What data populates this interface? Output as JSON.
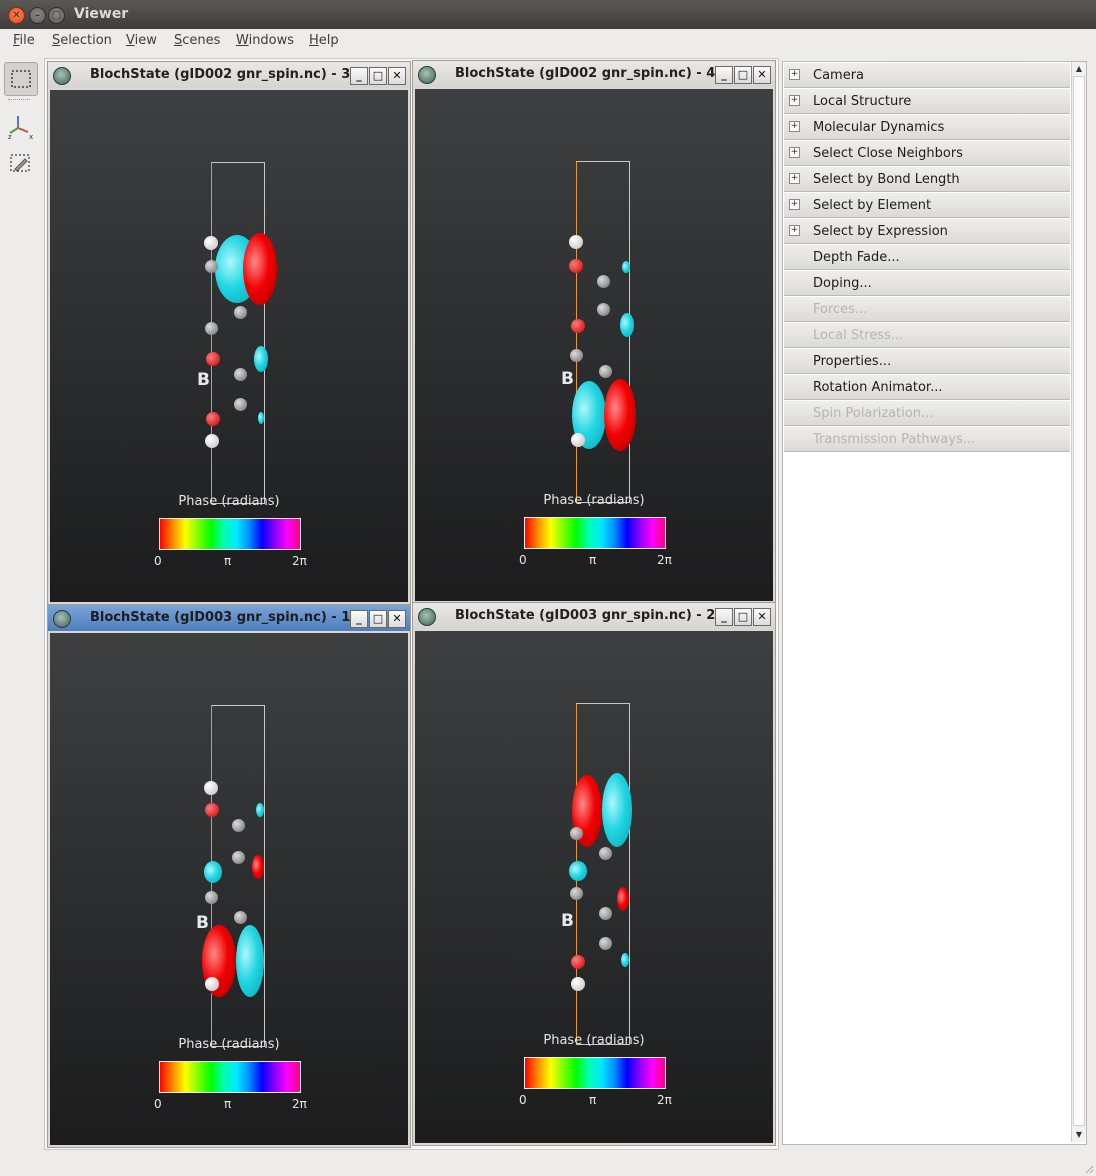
{
  "window": {
    "title": "Viewer"
  },
  "menu": [
    {
      "label": "File"
    },
    {
      "label": "Selection"
    },
    {
      "label": "View"
    },
    {
      "label": "Scenes"
    },
    {
      "label": "Windows"
    },
    {
      "label": "Help"
    }
  ],
  "toolbar": {
    "icons": [
      "rectangle-select-icon",
      "axis-icon",
      "lasso-select-icon"
    ]
  },
  "subwindows": [
    {
      "title": "BlochState (gID002 gnr_spin.nc) - 3",
      "active": false,
      "phase_label": "Phase (radians)",
      "ticks": [
        "0",
        "π",
        "2π"
      ],
      "atom_label": "B"
    },
    {
      "title": "BlochState (gID002 gnr_spin.nc) - 4",
      "active": false,
      "phase_label": "Phase (radians)",
      "ticks": [
        "0",
        "π",
        "2π"
      ],
      "atom_label": "B"
    },
    {
      "title": "BlochState (gID003 gnr_spin.nc) - 1",
      "active": true,
      "phase_label": "Phase (radians)",
      "ticks": [
        "0",
        "π",
        "2π"
      ],
      "atom_label": "B"
    },
    {
      "title": "BlochState (gID003 gnr_spin.nc) - 2",
      "active": false,
      "phase_label": "Phase (radians)",
      "ticks": [
        "0",
        "π",
        "2π"
      ],
      "atom_label": "B"
    }
  ],
  "subwindow_buttons": {
    "minimize": "_",
    "maximize": "□",
    "close": "✕"
  },
  "panel": {
    "items": [
      {
        "label": "Camera",
        "expandable": true,
        "enabled": true
      },
      {
        "label": "Local Structure",
        "expandable": true,
        "enabled": true
      },
      {
        "label": "Molecular Dynamics",
        "expandable": true,
        "enabled": true
      },
      {
        "label": "Select Close Neighbors",
        "expandable": true,
        "enabled": true
      },
      {
        "label": "Select by Bond Length",
        "expandable": true,
        "enabled": true
      },
      {
        "label": "Select by Element",
        "expandable": true,
        "enabled": true
      },
      {
        "label": "Select by Expression",
        "expandable": true,
        "enabled": true
      },
      {
        "label": "Depth Fade...",
        "expandable": false,
        "enabled": true
      },
      {
        "label": "Doping...",
        "expandable": false,
        "enabled": true
      },
      {
        "label": "Forces...",
        "expandable": false,
        "enabled": false
      },
      {
        "label": "Local Stress...",
        "expandable": false,
        "enabled": false
      },
      {
        "label": "Properties...",
        "expandable": false,
        "enabled": true
      },
      {
        "label": "Rotation Animator...",
        "expandable": false,
        "enabled": true
      },
      {
        "label": "Spin Polarization...",
        "expandable": false,
        "enabled": false
      },
      {
        "label": "Transmission Pathways...",
        "expandable": false,
        "enabled": false
      }
    ]
  },
  "colors": {
    "accent_active_title": "#4d7fbd",
    "viewport_bg": "#1c1c1d",
    "lobe_positive": "#20d6e2",
    "lobe_negative": "#f20000"
  }
}
